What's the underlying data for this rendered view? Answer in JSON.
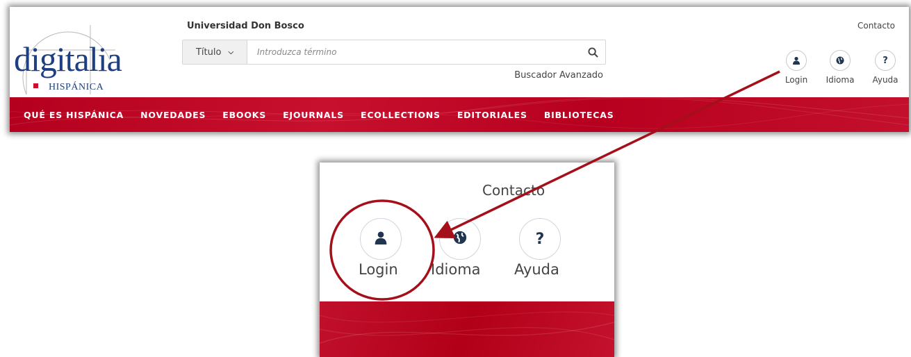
{
  "header": {
    "institution": "Universidad Don Bosco",
    "contact": "Contacto",
    "logo": {
      "word": "digitalia",
      "sub": "HISPÁNICA"
    },
    "search": {
      "field_selected": "Título",
      "placeholder": "Introduzca término",
      "advanced_label": "Buscador Avanzado"
    },
    "icons": [
      {
        "label": "Login",
        "icon": "user-icon"
      },
      {
        "label": "Idioma",
        "icon": "globe-icon"
      },
      {
        "label": "Ayuda",
        "icon": "question-icon"
      }
    ]
  },
  "nav": {
    "items": [
      "QUÉ ES HISPÁNICA",
      "NOVEDADES",
      "EBOOKS",
      "EJOURNALS",
      "ECOLLECTIONS",
      "EDITORIALES",
      "BIBLIOTECAS"
    ]
  },
  "zoom": {
    "contact": "Contacto",
    "icons": [
      {
        "label": "Login",
        "icon": "user-icon"
      },
      {
        "label": "Idioma",
        "icon": "globe-icon"
      },
      {
        "label": "Ayuda",
        "icon": "question-icon"
      }
    ]
  },
  "colors": {
    "brand_red": "#c8102e",
    "logo_blue": "#1f3f80",
    "annotation_red": "#a50f1a"
  }
}
